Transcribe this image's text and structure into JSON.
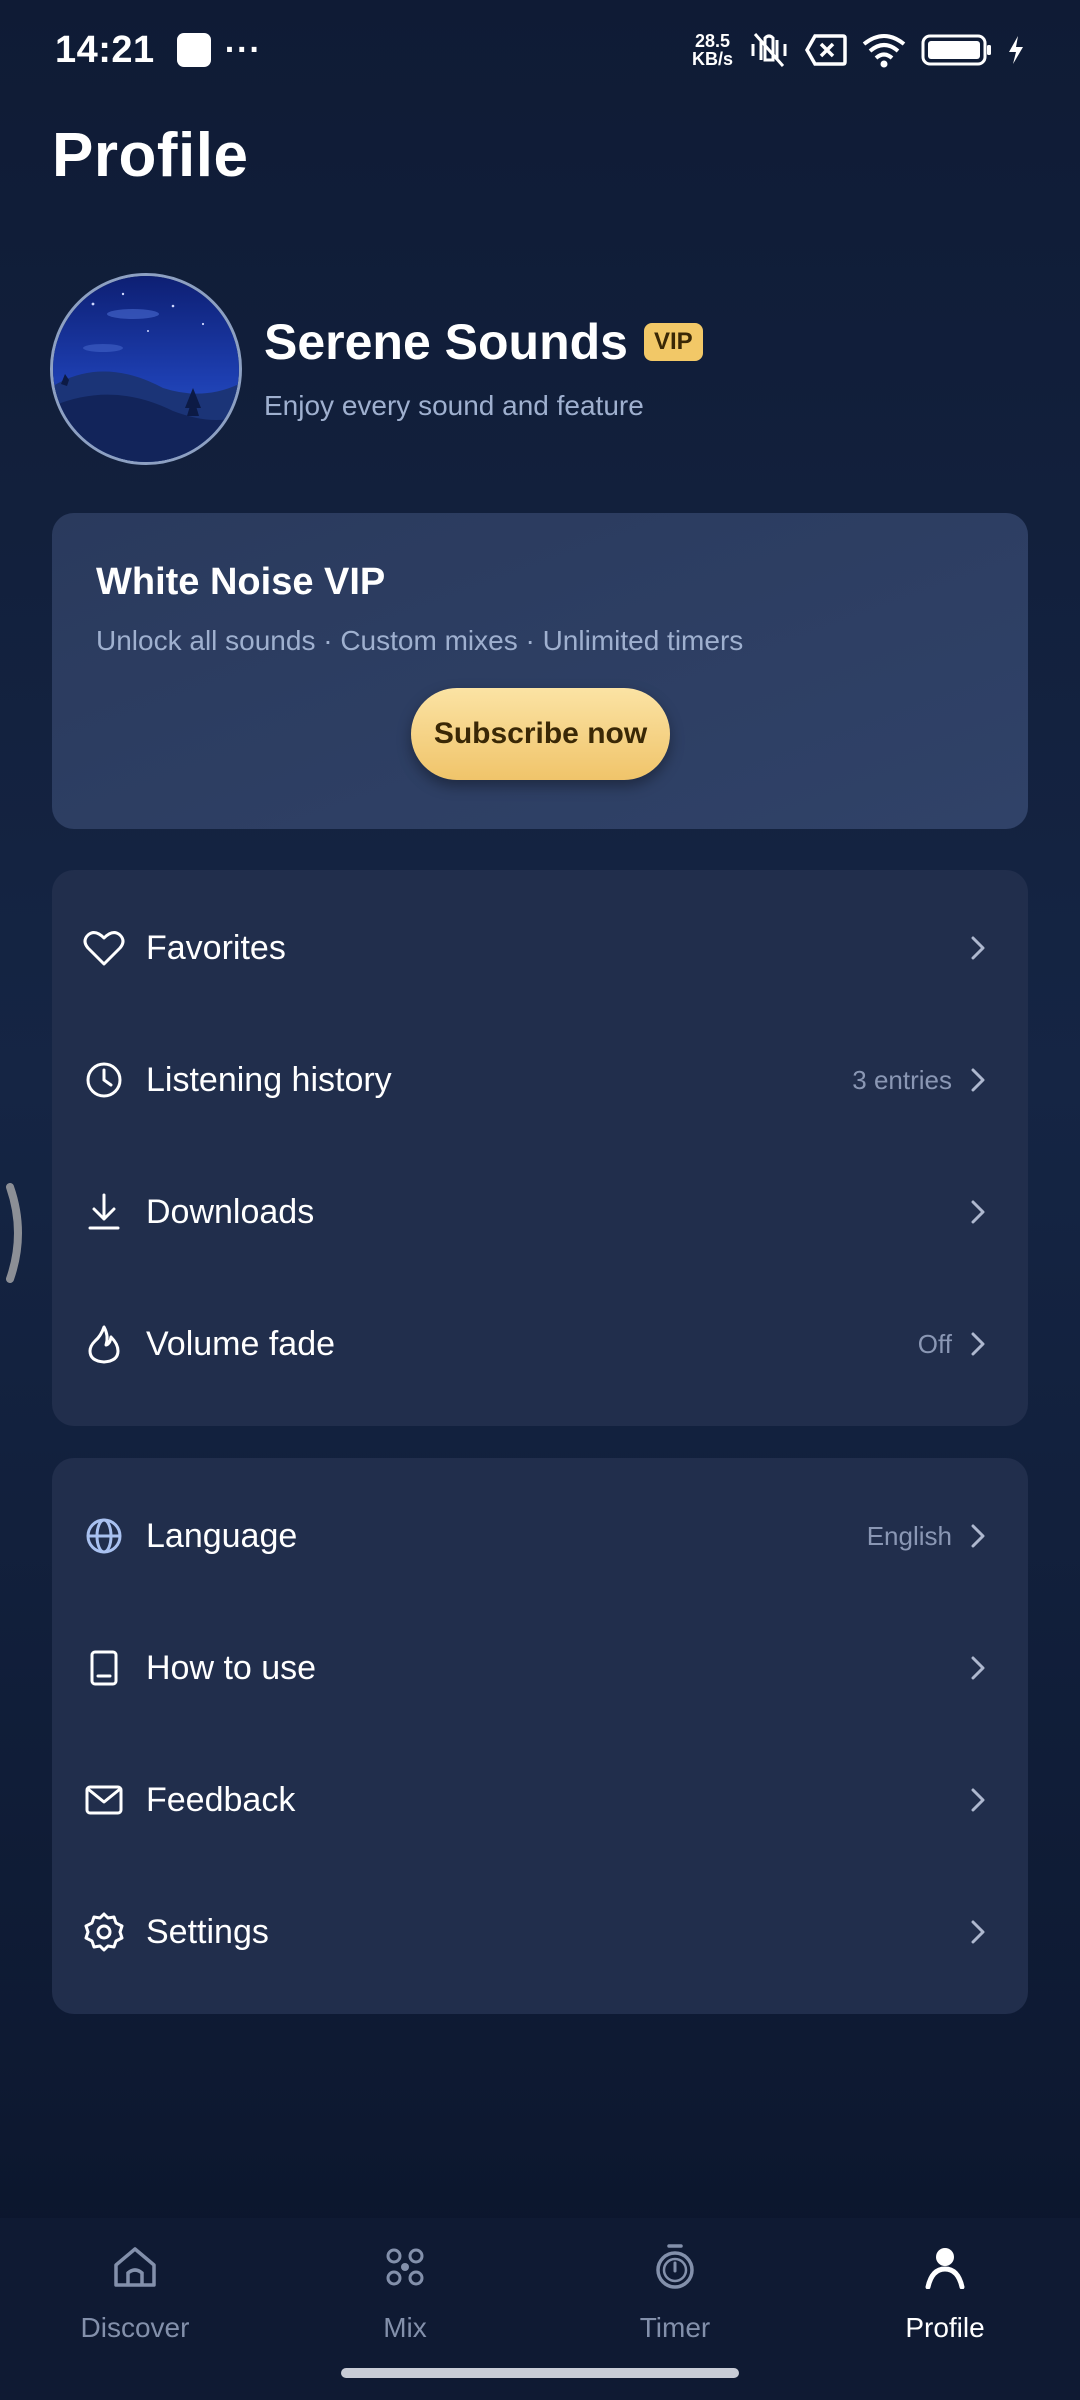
{
  "status_bar": {
    "time": "14:21",
    "speed_value": "28.5",
    "speed_unit": "KB/s",
    "icons": [
      "notification-square-icon",
      "more-dots-icon",
      "vibrate-off-icon",
      "sim-off-icon",
      "wifi-icon",
      "battery-icon",
      "charging-icon"
    ]
  },
  "page": {
    "title": "Profile"
  },
  "profile": {
    "name": "Serene Sounds",
    "badge": "VIP",
    "subtitle": "Enjoy every sound and feature"
  },
  "vip_card": {
    "title": "White Noise VIP",
    "features": "Unlock all sounds · Custom mixes · Unlimited timers",
    "button_label": "Subscribe now"
  },
  "menu_primary": [
    {
      "label": "Favorites",
      "value": "",
      "icon": "heart-icon"
    },
    {
      "label": "Listening history",
      "value": "3 entries",
      "icon": "clock-icon"
    },
    {
      "label": "Downloads",
      "value": "",
      "icon": "download-icon"
    },
    {
      "label": "Volume fade",
      "value": "Off",
      "icon": "flame-icon"
    }
  ],
  "menu_secondary": [
    {
      "label": "Language",
      "value": "English",
      "icon": "globe-icon"
    },
    {
      "label": "How to use",
      "value": "",
      "icon": "book-icon"
    },
    {
      "label": "Feedback",
      "value": "",
      "icon": "mail-icon"
    },
    {
      "label": "Settings",
      "value": "",
      "icon": "gear-icon"
    }
  ],
  "bottom_nav": [
    {
      "label": "Discover",
      "icon": "home-icon",
      "active": false
    },
    {
      "label": "Mix",
      "icon": "mix-icon",
      "active": false
    },
    {
      "label": "Timer",
      "icon": "stopwatch-icon",
      "active": false
    },
    {
      "label": "Profile",
      "icon": "person-icon",
      "active": true
    }
  ],
  "colors": {
    "background": "#132140",
    "card": "#212e4c",
    "vip_gold": "#f2c867",
    "muted_text": "#9fb0cf",
    "nav_inactive": "#8390ab"
  }
}
